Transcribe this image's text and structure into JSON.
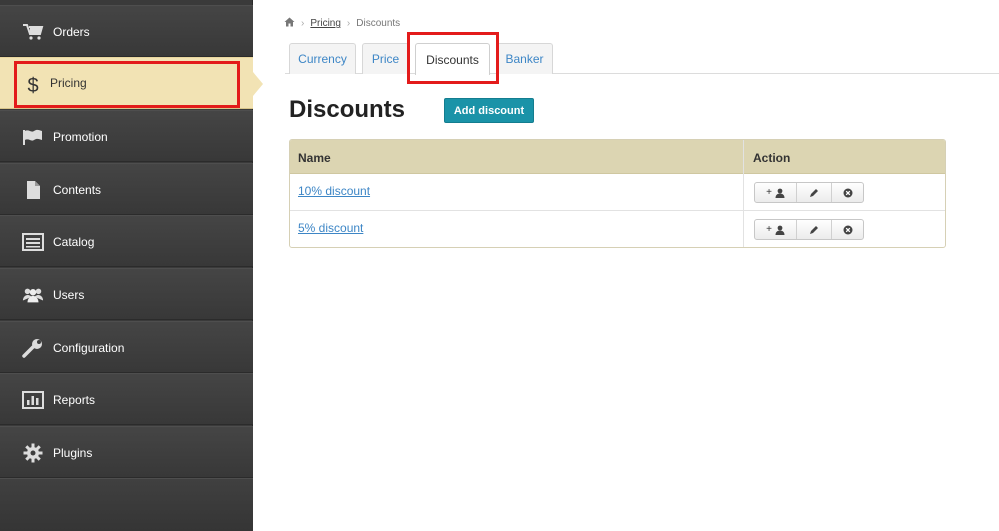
{
  "sidebar": {
    "items": [
      {
        "label": "Orders",
        "icon": "cart-icon"
      },
      {
        "label": "Pricing",
        "icon": "dollar-icon"
      },
      {
        "label": "Promotion",
        "icon": "flag-icon"
      },
      {
        "label": "Contents",
        "icon": "document-icon"
      },
      {
        "label": "Catalog",
        "icon": "list-icon"
      },
      {
        "label": "Users",
        "icon": "users-icon"
      },
      {
        "label": "Configuration",
        "icon": "wrench-icon"
      },
      {
        "label": "Reports",
        "icon": "bar-chart-icon"
      },
      {
        "label": "Plugins",
        "icon": "gear-icon"
      }
    ],
    "active": "Pricing",
    "pricing_symbol": "$"
  },
  "breadcrumb": {
    "items": [
      "Pricing",
      "Discounts"
    ],
    "separator": "›"
  },
  "tabs": [
    {
      "label": "Currency"
    },
    {
      "label": "Price"
    },
    {
      "label": "Discounts"
    },
    {
      "label": "Banker"
    }
  ],
  "page": {
    "title": "Discounts",
    "add_button": "Add discount"
  },
  "table": {
    "headers": [
      "Name",
      "Action"
    ],
    "rows": [
      {
        "name": "10% discount"
      },
      {
        "name": "5% discount"
      }
    ],
    "action_plus": "+"
  },
  "colors": {
    "accent": "#1a93a8",
    "highlight": "#e31b1b",
    "active_item": "#f2e3b4",
    "table_header": "#dcd5b2"
  }
}
